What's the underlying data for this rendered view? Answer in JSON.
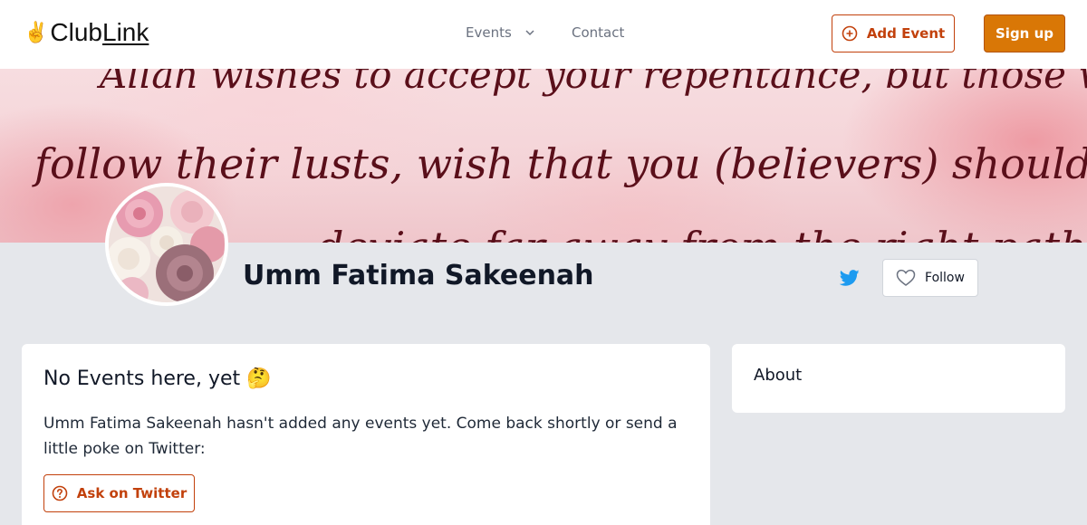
{
  "header": {
    "logo_text": "Club",
    "logo_link_text": "Link",
    "logo_icon": "victory-hand-icon",
    "nav": [
      {
        "label": "Events",
        "has_dropdown": true
      },
      {
        "label": "Contact",
        "has_dropdown": false
      }
    ],
    "add_event_label": "Add Event",
    "signup_label": "Sign up"
  },
  "banner": {
    "lines": [
      "Allah wishes to accept your repentance, but those who",
      "follow their lusts, wish that you (believers) should",
      "deviate far away from the right path"
    ]
  },
  "profile": {
    "name": "Umm Fatima Sakeenah",
    "twitter_icon": "twitter-icon",
    "follow_label": "Follow"
  },
  "main_card": {
    "title": "No Events here, yet 🤔",
    "text": "Umm Fatima Sakeenah hasn't added any events yet. Come back shortly or send a little poke on Twitter:",
    "ask_label": "Ask on Twitter"
  },
  "about_card": {
    "title": "About"
  },
  "colors": {
    "accent": "#d97706",
    "accent_border": "#c2410c",
    "twitter": "#1d9bf0",
    "background": "#e5e7eb"
  }
}
